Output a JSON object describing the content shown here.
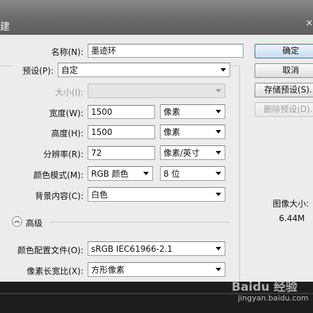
{
  "window": {
    "title_fragment": "建",
    "close_glyph": "×"
  },
  "form": {
    "name": {
      "label": "名称(N):",
      "value": "墨迹环"
    },
    "preset": {
      "label": "预设(P):",
      "value": "自定"
    },
    "size": {
      "label": "大小(I):",
      "value": ""
    },
    "width": {
      "label": "宽度(W):",
      "value": "1500",
      "unit": "像素"
    },
    "height": {
      "label": "高度(H):",
      "value": "1500",
      "unit": "像素"
    },
    "resolution": {
      "label": "分辨率(R):",
      "value": "72",
      "unit": "像素/英寸"
    },
    "color_mode": {
      "label": "颜色模式(M):",
      "value": "RGB 颜色",
      "depth": "8 位"
    },
    "background": {
      "label": "背景内容(C):",
      "value": "白色"
    },
    "advanced": {
      "label": "高级"
    },
    "color_profile": {
      "label": "颜色配置文件(O):",
      "value": "sRGB IEC61966-2.1"
    },
    "pixel_aspect": {
      "label": "像素长宽比(X):",
      "value": "方形像素"
    }
  },
  "buttons": {
    "ok": "确定",
    "cancel": "取消",
    "save_preset": "存储预设(S)...",
    "delete_preset": "删除预设(D)..."
  },
  "image_size": {
    "label": "图像大小:",
    "value": "6.44M"
  },
  "watermark": {
    "logo": "Baidu 经验",
    "url": "jingyan.baidu.com"
  }
}
